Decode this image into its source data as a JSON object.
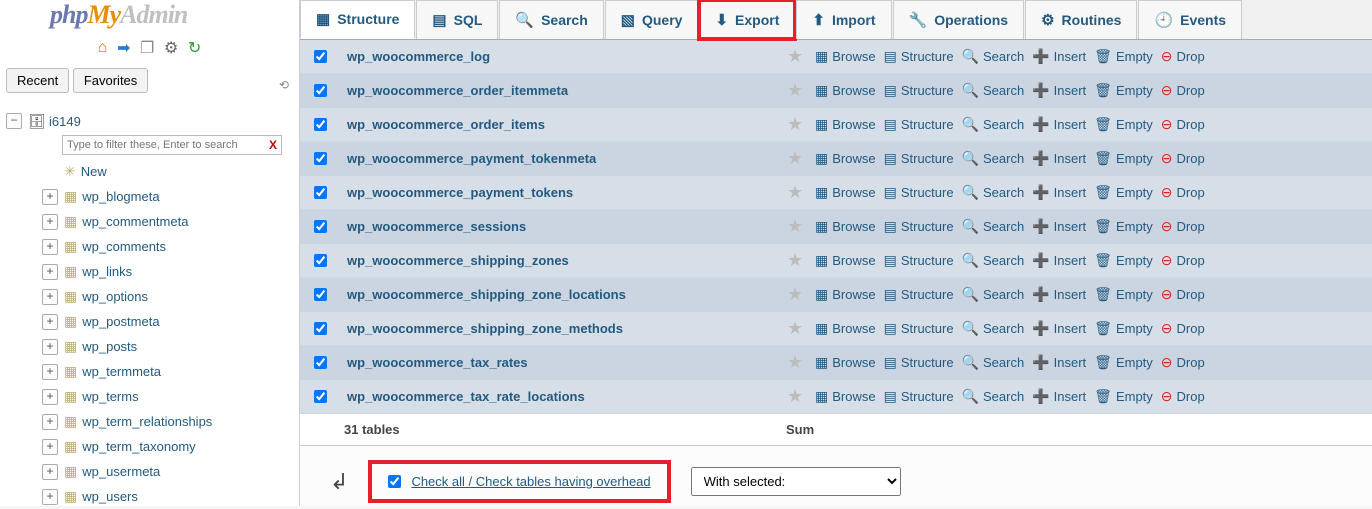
{
  "sidebar": {
    "logo_p1": "php",
    "logo_p2": "My",
    "logo_p3": "Admin",
    "recent": "Recent",
    "favorites": "Favorites",
    "db_name": "i6149",
    "filter_placeholder": "Type to filter these, Enter to search",
    "new_label": "New",
    "tables": [
      "wp_blogmeta",
      "wp_commentmeta",
      "wp_comments",
      "wp_links",
      "wp_options",
      "wp_postmeta",
      "wp_posts",
      "wp_termmeta",
      "wp_terms",
      "wp_term_relationships",
      "wp_term_taxonomy",
      "wp_usermeta",
      "wp_users"
    ]
  },
  "tabs": [
    {
      "label": "Structure",
      "active": true
    },
    {
      "label": "SQL"
    },
    {
      "label": "Search"
    },
    {
      "label": "Query"
    },
    {
      "label": "Export",
      "highlight": true
    },
    {
      "label": "Import"
    },
    {
      "label": "Operations"
    },
    {
      "label": "Routines"
    },
    {
      "label": "Events"
    }
  ],
  "action_labels": {
    "browse": "Browse",
    "structure": "Structure",
    "search": "Search",
    "insert": "Insert",
    "empty": "Empty",
    "drop": "Drop"
  },
  "tables": [
    "wp_woocommerce_log",
    "wp_woocommerce_order_itemmeta",
    "wp_woocommerce_order_items",
    "wp_woocommerce_payment_tokenmeta",
    "wp_woocommerce_payment_tokens",
    "wp_woocommerce_sessions",
    "wp_woocommerce_shipping_zones",
    "wp_woocommerce_shipping_zone_locations",
    "wp_woocommerce_shipping_zone_methods",
    "wp_woocommerce_tax_rates",
    "wp_woocommerce_tax_rate_locations"
  ],
  "summary": {
    "count": "31 tables",
    "sum": "Sum"
  },
  "checkall": "Check all / Check tables having overhead",
  "with_selected_label": "With selected:"
}
